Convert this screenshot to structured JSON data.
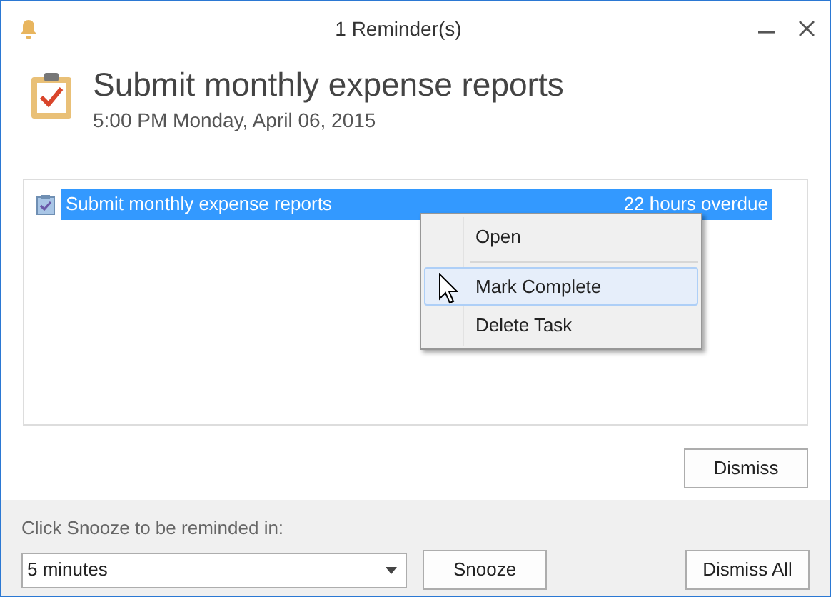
{
  "window": {
    "title": "1 Reminder(s)"
  },
  "header": {
    "subject": "Submit monthly expense reports",
    "time": "5:00 PM Monday, April 06, 2015"
  },
  "reminders": [
    {
      "subject": "Submit monthly expense reports",
      "due": "22 hours overdue",
      "selected": true
    }
  ],
  "context_menu": {
    "items": [
      {
        "label": "Open",
        "hovered": false,
        "separator_after": true
      },
      {
        "label": "Mark Complete",
        "hovered": true,
        "separator_after": false
      },
      {
        "label": "Delete Task",
        "hovered": false,
        "separator_after": false
      }
    ]
  },
  "dismiss_button": "Dismiss",
  "snooze": {
    "prompt": "Click Snooze to be reminded in:",
    "value": "5 minutes",
    "button": "Snooze"
  },
  "dismiss_all_button": "Dismiss All"
}
